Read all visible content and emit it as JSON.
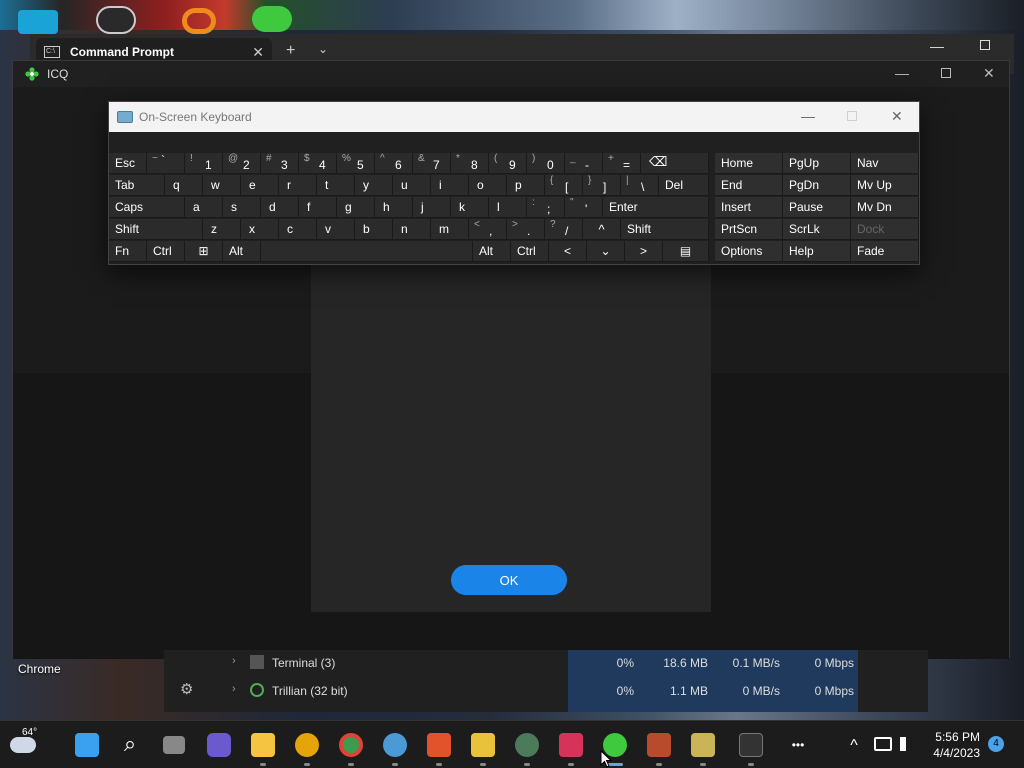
{
  "desktop": {
    "chrome_label": "Chrome"
  },
  "command_prompt": {
    "tab_title": "Command Prompt",
    "tab_icon": "C:\\",
    "close_glyph": "✕",
    "newtab_glyph": "+",
    "dropdown_glyph": "⌄",
    "minimize_glyph": "—"
  },
  "icq": {
    "title": "ICQ",
    "minimize_glyph": "—",
    "close_glyph": "✕",
    "ok_label": "OK",
    "brand_color": "#1a84e8"
  },
  "osk": {
    "title": "On-Screen Keyboard",
    "minimize_glyph": "—",
    "close_glyph": "✕",
    "row1": [
      {
        "label": "Esc"
      },
      {
        "shift": "~",
        "main": "`"
      },
      {
        "shift": "!",
        "main": "1"
      },
      {
        "shift": "@",
        "main": "2"
      },
      {
        "shift": "#",
        "main": "3"
      },
      {
        "shift": "$",
        "main": "4"
      },
      {
        "shift": "%",
        "main": "5"
      },
      {
        "shift": "^",
        "main": "6"
      },
      {
        "shift": "&",
        "main": "7"
      },
      {
        "shift": "*",
        "main": "8"
      },
      {
        "shift": "(",
        "main": "9"
      },
      {
        "shift": ")",
        "main": "0"
      },
      {
        "shift": "_",
        "main": "-"
      },
      {
        "shift": "+",
        "main": "="
      },
      {
        "label": "⌫"
      }
    ],
    "row2": [
      {
        "label": "Tab"
      },
      {
        "label": "q"
      },
      {
        "label": "w"
      },
      {
        "label": "e"
      },
      {
        "label": "r"
      },
      {
        "label": "t"
      },
      {
        "label": "y"
      },
      {
        "label": "u"
      },
      {
        "label": "i"
      },
      {
        "label": "o"
      },
      {
        "label": "p"
      },
      {
        "shift": "{",
        "main": "["
      },
      {
        "shift": "}",
        "main": "]"
      },
      {
        "shift": "|",
        "main": "\\"
      },
      {
        "label": "Del"
      }
    ],
    "row3": [
      {
        "label": "Caps"
      },
      {
        "label": "a"
      },
      {
        "label": "s"
      },
      {
        "label": "d"
      },
      {
        "label": "f"
      },
      {
        "label": "g"
      },
      {
        "label": "h"
      },
      {
        "label": "j"
      },
      {
        "label": "k"
      },
      {
        "label": "l"
      },
      {
        "shift": ":",
        "main": ";"
      },
      {
        "shift": "\"",
        "main": "'"
      },
      {
        "label": "Enter"
      }
    ],
    "row4": [
      {
        "label": "Shift"
      },
      {
        "label": "z"
      },
      {
        "label": "x"
      },
      {
        "label": "c"
      },
      {
        "label": "v"
      },
      {
        "label": "b"
      },
      {
        "label": "n"
      },
      {
        "label": "m"
      },
      {
        "shift": "<",
        "main": ","
      },
      {
        "shift": ">",
        "main": "."
      },
      {
        "shift": "?",
        "main": "/"
      },
      {
        "label": "^"
      },
      {
        "label": "Shift"
      }
    ],
    "row5": [
      {
        "label": "Fn"
      },
      {
        "label": "Ctrl"
      },
      {
        "label": "⊞"
      },
      {
        "label": "Alt"
      },
      {
        "label": ""
      },
      {
        "label": "Alt"
      },
      {
        "label": "Ctrl"
      },
      {
        "label": "<"
      },
      {
        "label": "⌄"
      },
      {
        "label": ">"
      },
      {
        "label": "▤"
      }
    ],
    "nav": [
      [
        "Home",
        "PgUp",
        "Nav"
      ],
      [
        "End",
        "PgDn",
        "Mv Up"
      ],
      [
        "Insert",
        "Pause",
        "Mv Dn"
      ],
      [
        "PrtScn",
        "ScrLk",
        "Dock"
      ],
      [
        "Options",
        "Help",
        "Fade"
      ]
    ]
  },
  "task_manager": {
    "rows": [
      {
        "name": "Terminal (3)",
        "cpu": "0%",
        "memory": "18.6 MB",
        "disk": "0.1 MB/s",
        "network": "0 Mbps"
      },
      {
        "name": "Trillian (32 bit)",
        "cpu": "0%",
        "memory": "1.1 MB",
        "disk": "0 MB/s",
        "network": "0 Mbps"
      }
    ],
    "settings_glyph": "⚙",
    "chevron_glyph": "›"
  },
  "taskbar": {
    "weather_temp": "64°",
    "time": "5:56 PM",
    "date": "4/4/2023",
    "notification_count": "4",
    "more_glyph": "•••",
    "chevron_up_glyph": "^",
    "search_glyph": "⌕",
    "icons": [
      "weather-icon",
      "start-icon",
      "search-icon",
      "task-view-icon",
      "teams-chat-icon",
      "file-explorer-icon",
      "chrome-canary-icon",
      "chrome-icon",
      "app-blue-icon",
      "t-app-icon",
      "help-icon",
      "trillian-icon",
      "paint-icon",
      "icq-icon",
      "winrar-icon",
      "box-app-icon",
      "terminal-icon",
      "more-icon"
    ]
  },
  "colors": {
    "accent_blue": "#1a84e8",
    "icq_green": "#3ec93e",
    "keyboard_bg": "#202020",
    "key_bg": "#2b2b2b"
  }
}
